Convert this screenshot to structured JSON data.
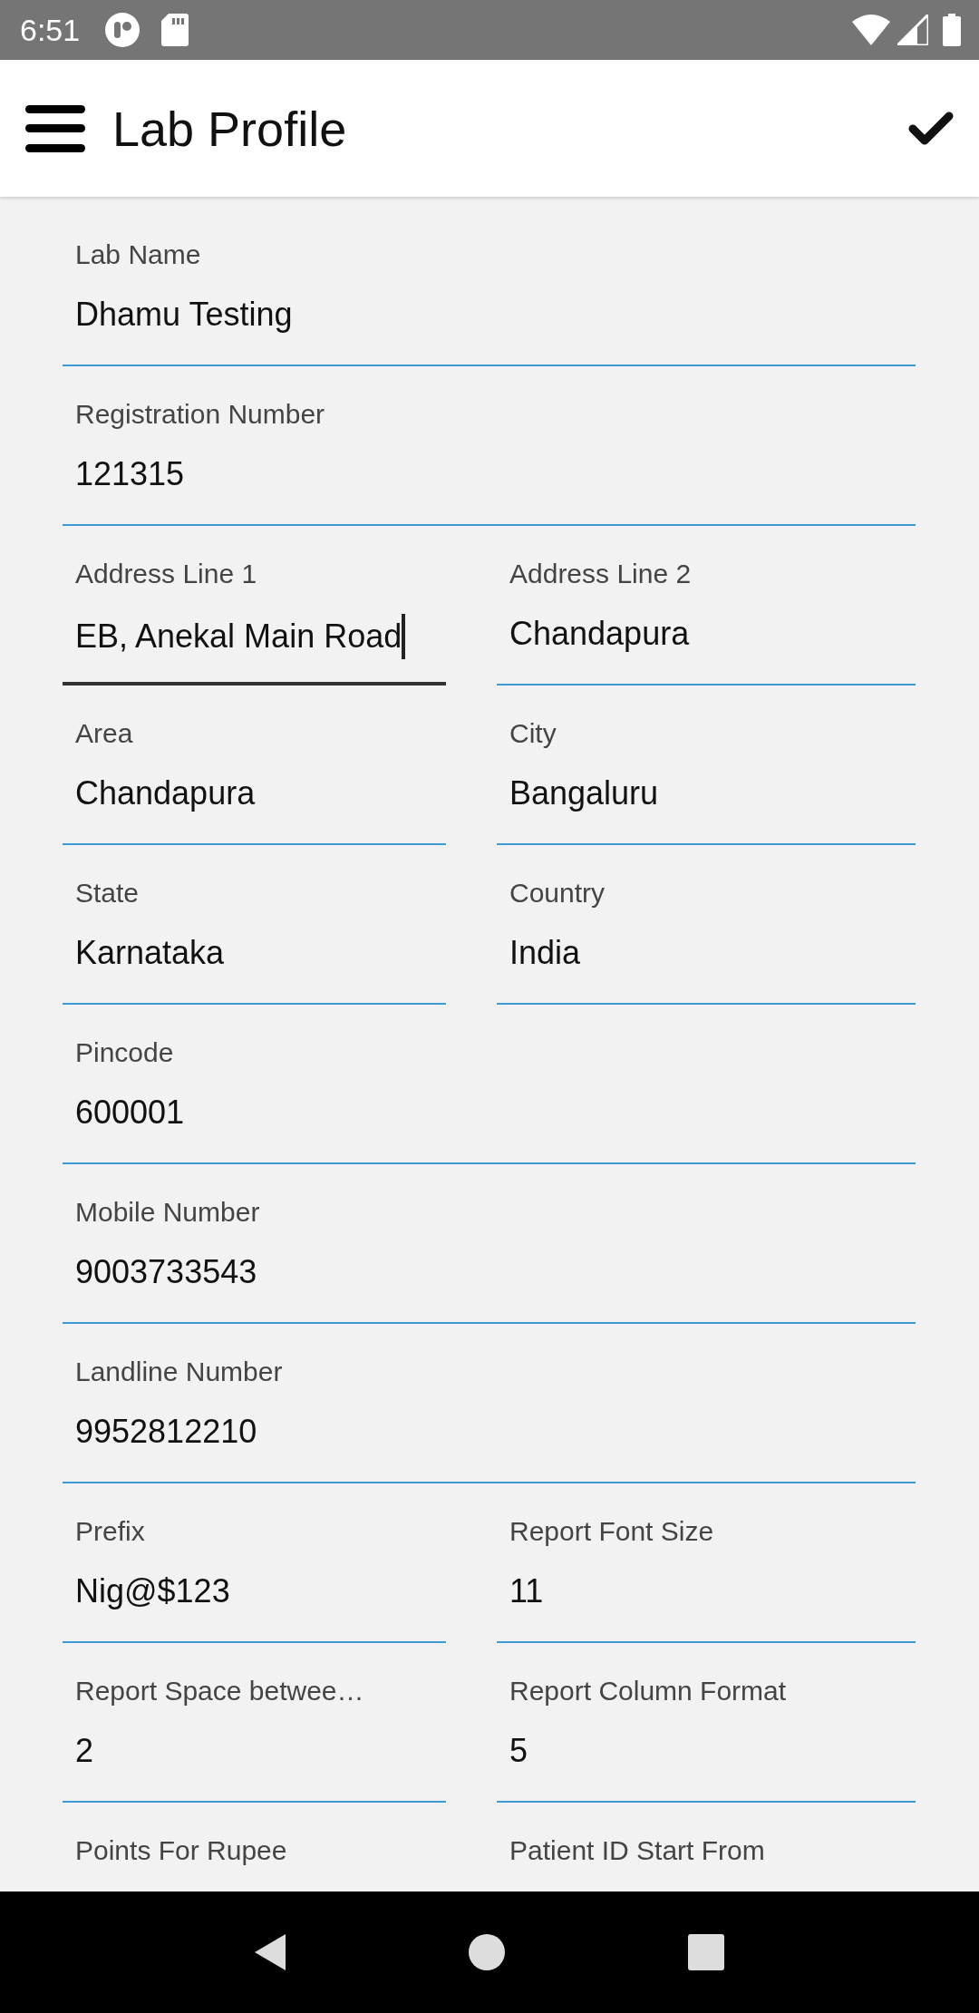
{
  "status_bar": {
    "time": "6:51"
  },
  "app_bar": {
    "title": "Lab Profile"
  },
  "form": {
    "rows": [
      [
        {
          "label": "Lab Name",
          "value": "Dhamu Testing",
          "focused": false
        }
      ],
      [
        {
          "label": "Registration Number",
          "value": "121315",
          "focused": false
        }
      ],
      [
        {
          "label": "Address Line 1",
          "value": "EB, Anekal Main Road",
          "focused": true
        },
        {
          "label": "Address Line 2",
          "value": "Chandapura",
          "focused": false
        }
      ],
      [
        {
          "label": "Area",
          "value": "Chandapura",
          "focused": false
        },
        {
          "label": "City",
          "value": "Bangaluru",
          "focused": false
        }
      ],
      [
        {
          "label": "State",
          "value": "Karnataka",
          "focused": false
        },
        {
          "label": "Country",
          "value": "India",
          "focused": false
        }
      ],
      [
        {
          "label": "Pincode",
          "value": "600001",
          "focused": false
        }
      ],
      [
        {
          "label": "Mobile Number",
          "value": "9003733543",
          "focused": false
        }
      ],
      [
        {
          "label": "Landline Number",
          "value": "9952812210",
          "focused": false
        }
      ],
      [
        {
          "label": "Prefix",
          "value": "Nig@$123",
          "focused": false
        },
        {
          "label": "Report Font Size",
          "value": "11",
          "focused": false
        }
      ],
      [
        {
          "label": "Report Space betwee…",
          "value": "2",
          "focused": false
        },
        {
          "label": "Report Column Format",
          "value": "5",
          "focused": false
        }
      ],
      [
        {
          "label": "Points For Rupee"
        },
        {
          "label": "Patient ID Start From"
        }
      ]
    ]
  }
}
